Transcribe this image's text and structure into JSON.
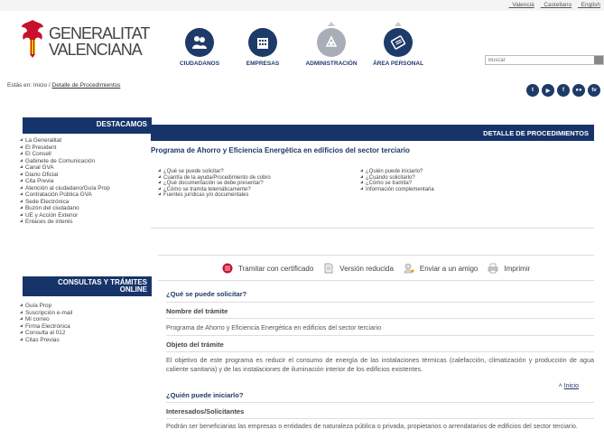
{
  "top_langs": [
    "_Valencià",
    "_Castellano",
    "_English"
  ],
  "logo": {
    "line1": "GENERALITAT",
    "line2": "VALENCIANA"
  },
  "nav": [
    {
      "label": "CIUDADANOS",
      "icon": "citizens-icon",
      "color": "#1e3a68"
    },
    {
      "label": "EMPRESAS",
      "icon": "business-icon",
      "color": "#1e3a68"
    },
    {
      "label": "ADMINISTRACIÓN",
      "icon": "administration-icon",
      "color": "#a7aeb8"
    },
    {
      "label": "ÁREA PERSONAL",
      "icon": "personal-area-icon",
      "color": "#1e3a68"
    }
  ],
  "search": {
    "placeholder": "Buscar"
  },
  "breadcrumb": {
    "prefix": "Estás en: Inicio / ",
    "current": "Detalle de Procedimientos"
  },
  "social": [
    "twitter-icon",
    "youtube-icon",
    "facebook-icon",
    "flickr-icon",
    "tv-icon"
  ],
  "social_glyphs": [
    "t",
    "▶",
    "f",
    "●●",
    "tv"
  ],
  "sidebar": {
    "destacamos_title": "DESTACAMOS",
    "destacamos": [
      "La Generalitat",
      "El President",
      "El Consell",
      "Gabinete de Comunicación",
      "Canal GVA",
      "Diario Oficial",
      "Cita Previa",
      "Atención al ciudadano/Guía Prop",
      "Contratación Pública GVA",
      "Sede Electrónica",
      "Buzón del ciudadano",
      "UE y Acción Exterior",
      "Enlaces de interés"
    ],
    "consultas_title_1": "CONSULTAS Y TRÁMITES",
    "consultas_title_2": "ONLINE",
    "consultas": [
      "Guía Prop",
      "Suscripción e-mail",
      "Mi correo",
      "Firma Electrónica",
      "Consulta al 012",
      "Citas Previas"
    ]
  },
  "main": {
    "bar_title": "DETALLE DE PROCEDIMIENTOS",
    "proc_title": "Programa de Ahorro y Eficiencia Energética en edificios del sector terciario",
    "toc_left": [
      "¿Qué se puede solicitar?",
      "Cuantía de la ayuda/Procedimiento de cobro",
      "¿Qué documentación se debe presentar?",
      "¿Cómo se tramita telemáticamente?",
      "Fuentes jurídicas y/o documentales"
    ],
    "toc_right": [
      "¿Quién puede iniciarlo?",
      "¿Cuándo solicitarlo?",
      "¿Cómo se tramita?",
      "Información complementaria"
    ],
    "actions": {
      "certificado": "Tramitar con certificado",
      "reducida": "Versión reducida",
      "amigo": "Enviar a un amigo",
      "imprimir": "Imprimir"
    },
    "s1_heading": "¿Qué se puede solicitar?",
    "s1_nombre_label": "Nombre del trámite",
    "s1_nombre_value": "Programa de Ahorro y Eficiencia Energética en edificios del sector terciario",
    "s1_objeto_label": "Objeto del trámite",
    "s1_objeto_value": "El objetivo de este programa es reducir el consumo de energía de las instalaciones térmicas (calefacción, climatización y producción de agua caliente sanitaria) y de las instalaciones de iluminación interior de los edificios existentes.",
    "inicio_link": "Inicio",
    "s2_heading": "¿Quién puede iniciarlo?",
    "s2_label": "Interesados/Solicitantes",
    "s2_value": "Podrán ser beneficiarias las empresas o entidades de naturaleza pública o privada, propietarios o arrendatarios de edificios del sector terciario."
  }
}
